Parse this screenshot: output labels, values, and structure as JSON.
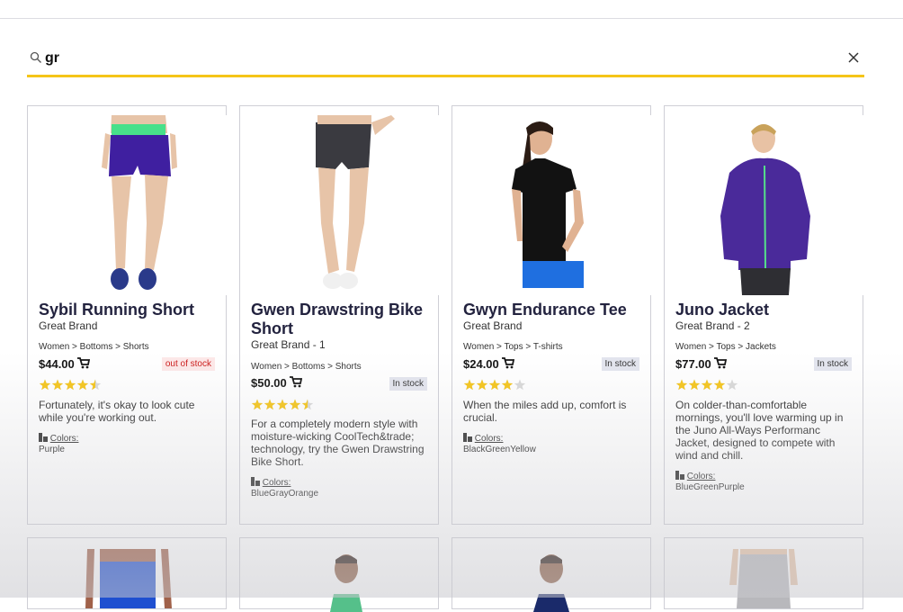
{
  "search": {
    "value": "gr",
    "placeholder": ""
  },
  "products": [
    {
      "title": "Sybil Running Short",
      "brand": "Great Brand",
      "breadcrumb": "Women > Bottoms > Shorts",
      "price": "$44.00",
      "stock": "out of stock",
      "rating": 4.5,
      "description": "Fortunately, it's okay to look cute while you're working out.",
      "colors_label": "Colors:",
      "colors": "Purple"
    },
    {
      "title": "Gwen Drawstring Bike Short",
      "brand": "Great Brand - 1",
      "breadcrumb": "Women > Bottoms > Shorts",
      "price": "$50.00",
      "stock": "In stock",
      "rating": 4.5,
      "description": "For a completely modern style with moisture-wicking CoolTech&trade; technology, try the Gwen Drawstring Bike Short.",
      "colors_label": "Colors:",
      "colors": "BlueGrayOrange"
    },
    {
      "title": "Gwyn Endurance Tee",
      "brand": "Great Brand",
      "breadcrumb": "Women > Tops > T-shirts",
      "price": "$24.00",
      "stock": "In stock",
      "rating": 4,
      "description": "When the miles add up, comfort is crucial.",
      "colors_label": "Colors:",
      "colors": "BlackGreenYellow"
    },
    {
      "title": "Juno Jacket",
      "brand": "Great Brand - 2",
      "breadcrumb": "Women > Tops > Jackets",
      "price": "$77.00",
      "stock": "In stock",
      "rating": 4,
      "description": "On colder-than-comfortable mornings, you'll love warming up in the Juno All-Ways Performanc Jacket, designed to compete with wind and chill.",
      "colors_label": "Colors:",
      "colors": "BlueGreenPurple"
    }
  ],
  "colors": {
    "accent": "#f5c518",
    "star": "#f5c518",
    "star_empty": "#d8d8d8",
    "out_of_stock": "#cc1b1b",
    "title": "#23233f"
  }
}
